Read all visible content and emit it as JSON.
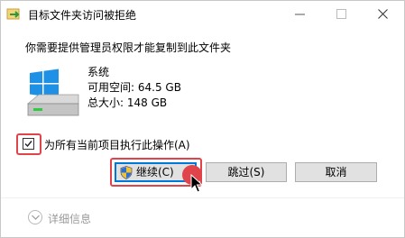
{
  "window": {
    "title": "目标文件夹访问被拒绝",
    "controls": {
      "minimize": "minimize-icon",
      "maximize": "maximize-icon",
      "close": "close-icon"
    }
  },
  "message": "你需要提供管理员权限才能复制到此文件夹",
  "drive": {
    "icon": "drive-icon",
    "name": "系统",
    "free_space": "可用空间: 64.5 GB",
    "total_size": "总大小: 148 GB"
  },
  "checkbox": {
    "label": "为所有当前项目执行此操作(A)",
    "checked": true
  },
  "buttons": {
    "continue_label": "继续(C)",
    "skip_label": "跳过(S)",
    "cancel_label": "取消"
  },
  "details_label": "详细信息",
  "colors": {
    "highlight": "#e0444a",
    "default_button_border": "#0078d7",
    "windows_blue": "#1e90e6"
  }
}
